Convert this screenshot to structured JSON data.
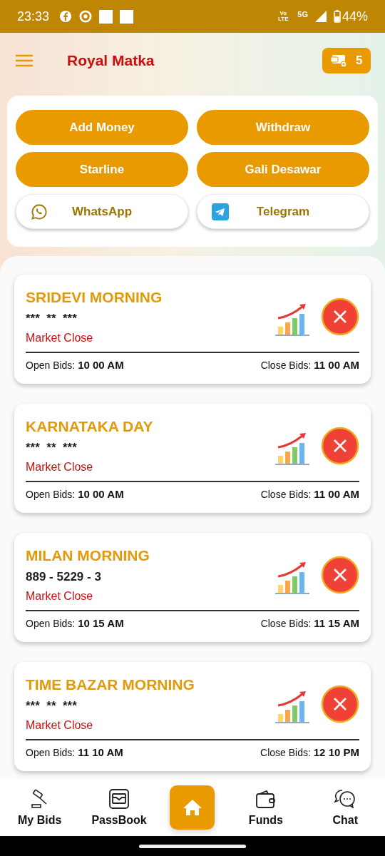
{
  "status_bar": {
    "time": "23:33",
    "network": "Vo LTE",
    "signal": "5G",
    "battery": "44%"
  },
  "header": {
    "title": "Royal Matka",
    "wallet_count": "5"
  },
  "actions": [
    {
      "label": "Add Money",
      "kind": "filled"
    },
    {
      "label": "Withdraw",
      "kind": "filled"
    },
    {
      "label": "Starline",
      "kind": "filled"
    },
    {
      "label": "Gali Desawar",
      "kind": "filled"
    },
    {
      "label": "WhatsApp",
      "kind": "whatsapp"
    },
    {
      "label": "Telegram",
      "kind": "telegram"
    }
  ],
  "markets": [
    {
      "name": "SRIDEVI MORNING",
      "result": "***  **  ***",
      "status": "Market Close",
      "open_label": "Open Bids:",
      "open_time": "10 00 AM",
      "close_label": "Close Bids:",
      "close_time": "11 00 AM",
      "is_open": false
    },
    {
      "name": "KARNATAKA DAY",
      "result": "***  **  ***",
      "status": "Market Close",
      "open_label": "Open Bids:",
      "open_time": "10 00 AM",
      "close_label": "Close Bids:",
      "close_time": "11 00 AM",
      "is_open": false
    },
    {
      "name": "MILAN MORNING",
      "result": "889 - 5229 - 3",
      "status": "Market Close",
      "open_label": "Open Bids:",
      "open_time": "10 15 AM",
      "close_label": "Close Bids:",
      "close_time": "11 15 AM",
      "is_open": false
    },
    {
      "name": "TIME BAZAR MORNING",
      "result": "***  **  ***",
      "status": "Market Close",
      "open_label": "Open Bids:",
      "open_time": "11 10 AM",
      "close_label": "Close Bids:",
      "close_time": "12 10 PM",
      "is_open": false
    }
  ],
  "bottom_nav": [
    {
      "label": "My Bids",
      "kind": "bids",
      "selected": false
    },
    {
      "label": "PassBook",
      "kind": "passbook",
      "selected": false
    },
    {
      "kind": "home",
      "selected": true
    },
    {
      "label": "Funds",
      "kind": "funds",
      "selected": false
    },
    {
      "label": "Chat",
      "kind": "chat",
      "selected": false
    }
  ]
}
